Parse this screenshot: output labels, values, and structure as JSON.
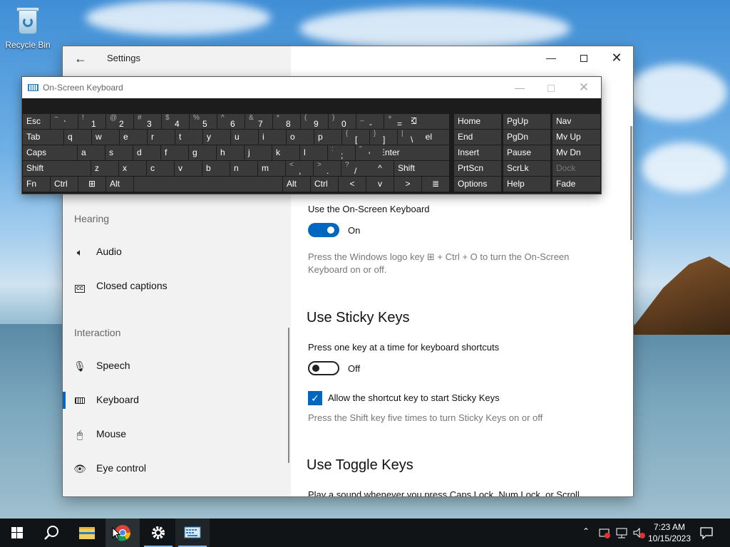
{
  "desktop": {
    "recycle_bin_label": "Recycle Bin"
  },
  "settings": {
    "title": "Settings",
    "back_glyph": "←",
    "controls": {
      "minimize": "—",
      "close": "✕"
    },
    "nav": {
      "hearing_header": "Hearing",
      "interaction_header": "Interaction",
      "items": [
        {
          "label": "Audio",
          "icon": "speaker-icon"
        },
        {
          "label": "Closed captions",
          "icon": "closed-captions-icon"
        },
        {
          "label": "Speech",
          "icon": "microphone-icon"
        },
        {
          "label": "Keyboard",
          "icon": "keyboard-icon",
          "active": true
        },
        {
          "label": "Mouse",
          "icon": "mouse-icon"
        },
        {
          "label": "Eye control",
          "icon": "eye-icon"
        }
      ],
      "cc_text": "CC"
    },
    "content": {
      "osk_label": "Use the On-Screen Keyboard",
      "osk_state": "On",
      "osk_hint": "Press the Windows logo key ⊞ + Ctrl + O to turn the On-Screen Keyboard on or off.",
      "sticky_heading": "Use Sticky Keys",
      "sticky_label": "Press one key at a time for keyboard shortcuts",
      "sticky_state": "Off",
      "sticky_checkbox_label": "Allow the shortcut key to start Sticky Keys",
      "sticky_hint": "Press the Shift key five times to turn Sticky Keys on or off",
      "toggle_heading": "Use Toggle Keys",
      "toggle_label": "Play a sound whenever you press Caps Lock, Num Lock, or Scroll"
    }
  },
  "osk": {
    "title": "On-Screen Keyboard",
    "controls": {
      "minimize": "—",
      "close": "✕"
    },
    "keys": {
      "esc": "Esc",
      "tab": "Tab",
      "caps": "Caps",
      "shift": "Shift",
      "rshift": "Shift",
      "fn": "Fn",
      "ctrl": "Ctrl",
      "alt": "Alt",
      "ralt": "Alt",
      "rctrl": "Ctrl",
      "enter": "Enter",
      "del": "Del",
      "backspace": "⌫",
      "num_row": [
        {
          "s": "~",
          "b": "`"
        },
        {
          "s": "!",
          "b": "1"
        },
        {
          "s": "@",
          "b": "2"
        },
        {
          "s": "#",
          "b": "3"
        },
        {
          "s": "$",
          "b": "4"
        },
        {
          "s": "%",
          "b": "5"
        },
        {
          "s": "^",
          "b": "6"
        },
        {
          "s": "&",
          "b": "7"
        },
        {
          "s": "*",
          "b": "8"
        },
        {
          "s": "(",
          "b": "9"
        },
        {
          "s": ")",
          "b": "0"
        },
        {
          "s": "_",
          "b": "-"
        },
        {
          "s": "+",
          "b": "="
        }
      ],
      "q_row": [
        "q",
        "w",
        "e",
        "r",
        "t",
        "y",
        "u",
        "i",
        "o",
        "p"
      ],
      "q_row_punct": [
        {
          "s": "{",
          "b": "["
        },
        {
          "s": "}",
          "b": "]"
        },
        {
          "s": "|",
          "b": "\\"
        }
      ],
      "a_row": [
        "a",
        "s",
        "d",
        "f",
        "g",
        "h",
        "j",
        "k",
        "l"
      ],
      "a_row_punct": [
        {
          "s": ":",
          "b": ";"
        },
        {
          "s": "\"",
          "b": "'"
        }
      ],
      "z_row": [
        "z",
        "x",
        "c",
        "v",
        "b",
        "n",
        "m"
      ],
      "z_row_punct": [
        {
          "s": "<",
          "b": ","
        },
        {
          "s": ">",
          "b": "."
        },
        {
          "s": "?",
          "b": "/"
        }
      ],
      "arrows": {
        "up": "^",
        "left": "<",
        "down": "v",
        "right": ">"
      },
      "menu": "≣",
      "nav_cols": [
        [
          "Home",
          "End",
          "Insert",
          "PrtScn",
          "Options"
        ],
        [
          "PgUp",
          "PgDn",
          "Pause",
          "ScrLk",
          "Help"
        ],
        [
          "Nav",
          "Mv Up",
          "Mv Dn",
          "Dock",
          "Fade"
        ]
      ]
    }
  },
  "taskbar": {
    "time": "7:23 AM",
    "date": "10/15/2023"
  }
}
